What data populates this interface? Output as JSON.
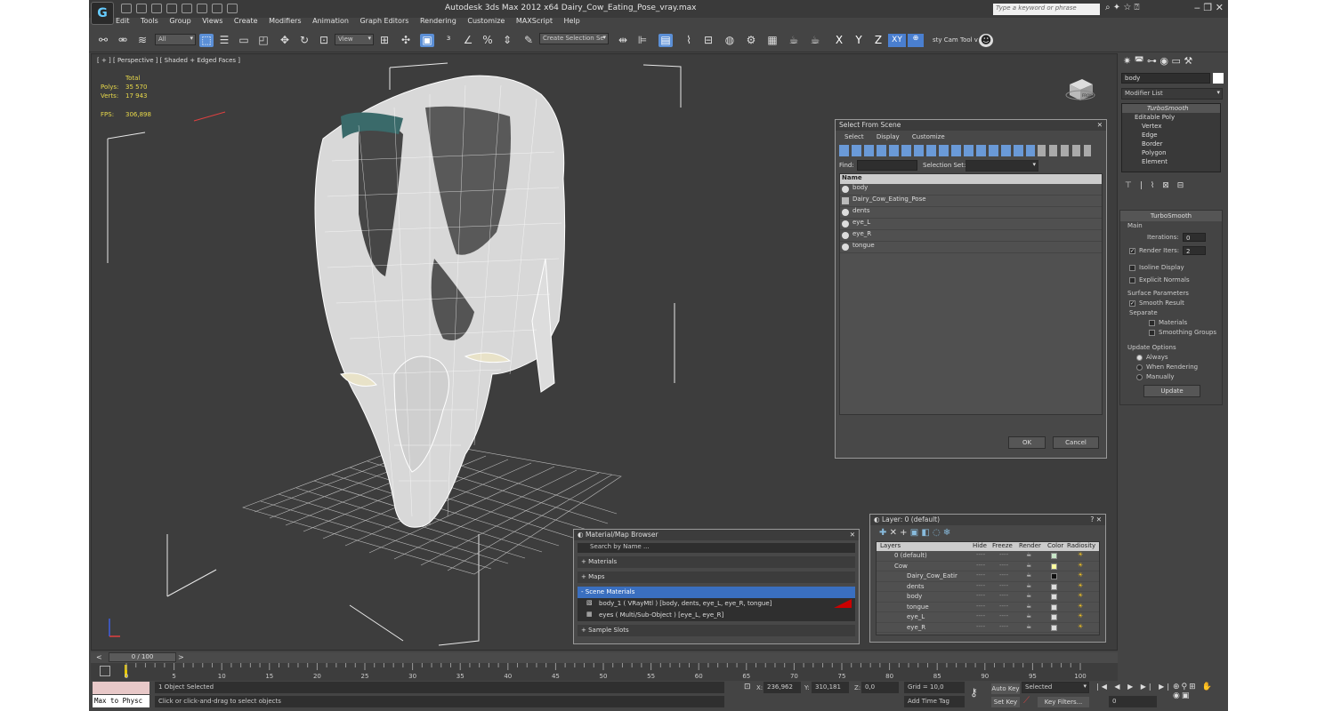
{
  "app": {
    "title": "Autodesk 3ds Max  2012 x64     Dairy_Cow_Eating_Pose_vray.max",
    "logo": "G",
    "search_placeholder": "Type a keyword or phrase"
  },
  "menu": [
    "Edit",
    "Tools",
    "Group",
    "Views",
    "Create",
    "Modifiers",
    "Animation",
    "Graph Editors",
    "Rendering",
    "Customize",
    "MAXScript",
    "Help"
  ],
  "toolbar": {
    "filter_value": "All",
    "refcoord_value": "View",
    "selection_set_value": "Create Selection Se",
    "axis_buttons": [
      "X",
      "Y",
      "Z",
      "XY"
    ],
    "cam_tool_label": "sty Cam Tool v"
  },
  "viewport": {
    "label": "[ + ] [ Perspective ] [ Shaded + Edged Faces ]",
    "stats": {
      "total_label": "Total",
      "polys_label": "Polys:",
      "polys_value": "35 570",
      "verts_label": "Verts:",
      "verts_value": "17 943",
      "fps_label": "FPS:",
      "fps_value": "306,898"
    },
    "viewcube_label": "FRONT"
  },
  "select_from_scene": {
    "title": "Select From Scene",
    "menu": [
      "Select",
      "Display",
      "Customize"
    ],
    "find_label": "Find:",
    "selection_set_label": "Selection Set:",
    "column_header": "Name",
    "items": [
      "body",
      "Dairy_Cow_Eating_Pose",
      "dents",
      "eye_L",
      "eye_R",
      "tongue"
    ],
    "ok_label": "OK",
    "cancel_label": "Cancel"
  },
  "material_browser": {
    "title": "Material/Map Browser",
    "search_placeholder": "Search by Name ...",
    "sections": [
      "+ Materials",
      "+ Maps",
      "- Scene Materials"
    ],
    "scene_materials": [
      "body_1  ( VRayMtl ) [body, dents, eye_L, eye_R, tongue]",
      "eyes  ( Multi/Sub-Object ) [eye_L, eye_R]"
    ],
    "sample_slots": "+ Sample Slots"
  },
  "layer_dialog": {
    "title": "Layer: 0 (default)",
    "columns": [
      "Layers",
      "Hide",
      "Freeze",
      "Render",
      "Color",
      "Radiosity"
    ],
    "rows": [
      "0 (default)",
      "Cow",
      "Dairy_Cow_Eatir",
      "dents",
      "body",
      "tongue",
      "eye_L",
      "eye_R"
    ],
    "dash": "----"
  },
  "command_panel": {
    "object_name": "body",
    "modifier_list_label": "Modifier List",
    "stack": [
      "TurboSmooth",
      "Editable Poly",
      "Vertex",
      "Edge",
      "Border",
      "Polygon",
      "Element"
    ],
    "turbosmooth_header": "TurboSmooth",
    "main_label": "Main",
    "iterations_label": "Iterations:",
    "iterations_value": "0",
    "render_iters_label": "Render Iters:",
    "render_iters_value": "2",
    "isoline_label": "Isoline Display",
    "explicit_normals_label": "Explicit Normals",
    "surface_params_label": "Surface Parameters",
    "smooth_result_label": "Smooth Result",
    "separate_label": "Separate",
    "materials_label": "Materials",
    "smoothing_groups_label": "Smoothing Groups",
    "update_options_label": "Update Options",
    "always_label": "Always",
    "when_rendering_label": "When Rendering",
    "manually_label": "Manually",
    "update_button": "Update"
  },
  "timeline": {
    "frame_display": "0 / 100",
    "ticks": [
      "0",
      "5",
      "10",
      "15",
      "20",
      "25",
      "30",
      "35",
      "40",
      "45",
      "50",
      "55",
      "60",
      "65",
      "70",
      "75",
      "80",
      "85",
      "90",
      "95",
      "100"
    ]
  },
  "status": {
    "maxscript_text": "Max to Physc",
    "selected_text": "1 Object Selected",
    "prompt_text": "Click or click-and-drag to select objects",
    "x_label": "X:",
    "x_value": "236,962",
    "y_label": "Y:",
    "y_value": "310,181",
    "z_label": "Z:",
    "z_value": "0,0",
    "grid_text": "Grid = 10,0",
    "add_time_tag": "Add Time Tag",
    "auto_key": "Auto Key",
    "set_key": "Set Key",
    "selected_dropdown": "Selected",
    "key_filters": "Key Filters...",
    "frame_value": "0"
  }
}
